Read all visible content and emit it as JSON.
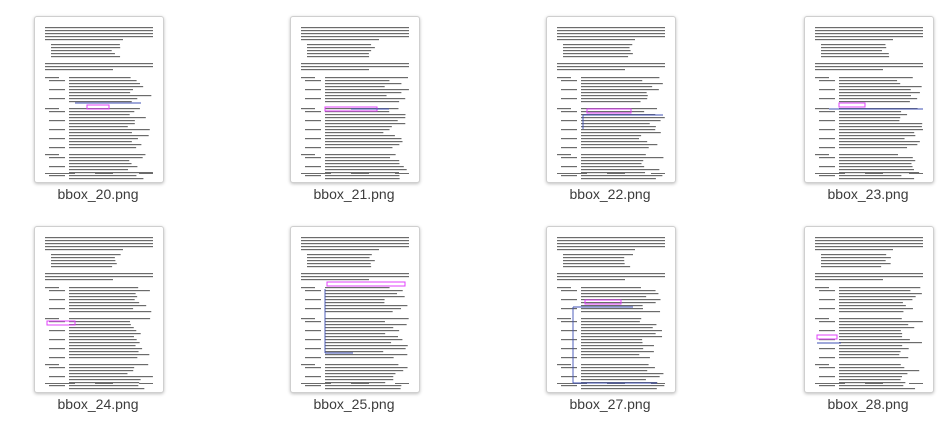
{
  "window": {
    "view": "file-manager-icon-grid"
  },
  "files": [
    {
      "name": "bbox_20.png",
      "icon": "image-thumbnail-icon",
      "overlay": "a"
    },
    {
      "name": "bbox_21.png",
      "icon": "image-thumbnail-icon",
      "overlay": "b"
    },
    {
      "name": "bbox_22.png",
      "icon": "image-thumbnail-icon",
      "overlay": "c"
    },
    {
      "name": "bbox_23.png",
      "icon": "image-thumbnail-icon",
      "overlay": "d"
    },
    {
      "name": "bbox_24.png",
      "icon": "image-thumbnail-icon",
      "overlay": "e"
    },
    {
      "name": "bbox_25.png",
      "icon": "image-thumbnail-icon",
      "overlay": "f"
    },
    {
      "name": "bbox_27.png",
      "icon": "image-thumbnail-icon",
      "overlay": "g"
    },
    {
      "name": "bbox_28.png",
      "icon": "image-thumbnail-icon",
      "overlay": "h"
    }
  ],
  "colors": {
    "text": "#3c3c3c",
    "doc_line": "#6b6b6b",
    "bbox_magenta": "#e040fb",
    "bbox_blue": "#3f51b5"
  }
}
